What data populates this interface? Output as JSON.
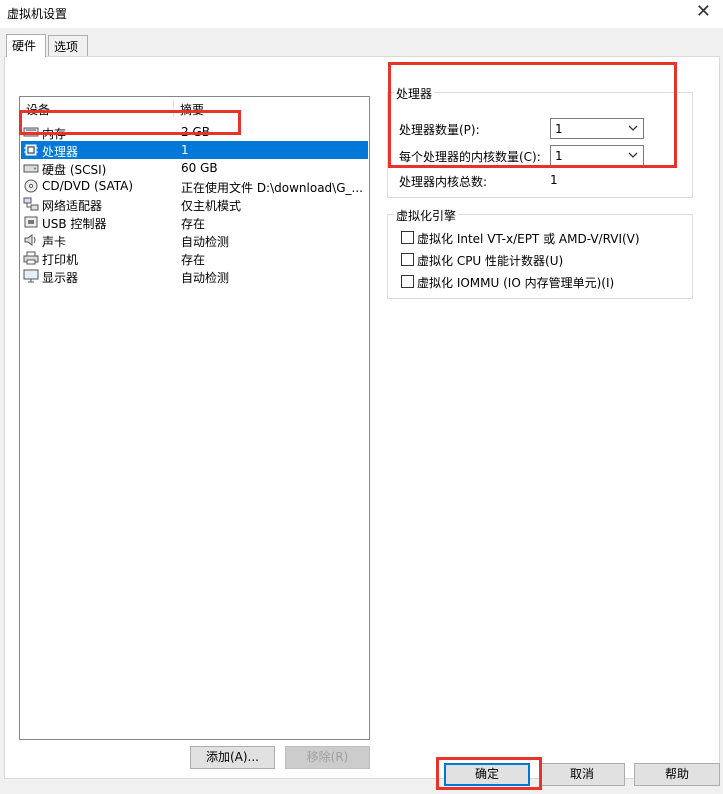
{
  "window": {
    "title": "虚拟机设置",
    "close_glyph": "✕"
  },
  "tabs": [
    {
      "label": "硬件"
    },
    {
      "label": "选项"
    }
  ],
  "device_list": {
    "headers": {
      "device": "设备",
      "summary": "摘要"
    },
    "rows": [
      {
        "name": "内存",
        "summary": "2 GB",
        "icon": "memory-icon"
      },
      {
        "name": "处理器",
        "summary": "1",
        "icon": "processor-icon"
      },
      {
        "name": "硬盘 (SCSI)",
        "summary": "60 GB",
        "icon": "hard-disk-icon"
      },
      {
        "name": "CD/DVD (SATA)",
        "summary": "正在使用文件 D:\\download\\G_...",
        "icon": "cd-dvd-icon"
      },
      {
        "name": "网络适配器",
        "summary": "仅主机模式",
        "icon": "network-adapter-icon"
      },
      {
        "name": "USB 控制器",
        "summary": "存在",
        "icon": "usb-icon"
      },
      {
        "name": "声卡",
        "summary": "自动检测",
        "icon": "speaker-icon"
      },
      {
        "name": "打印机",
        "summary": "存在",
        "icon": "printer-icon"
      },
      {
        "name": "显示器",
        "summary": "自动检测",
        "icon": "monitor-icon"
      }
    ],
    "selected_index": 1
  },
  "list_buttons": {
    "add": "添加(A)...",
    "remove": "移除(R)"
  },
  "processor_group": {
    "title": "处理器",
    "count_label": "处理器数量(P):",
    "count_value": "1",
    "cores_label": "每个处理器的内核数量(C):",
    "cores_value": "1",
    "total_label": "处理器内核总数:",
    "total_value": "1"
  },
  "virtualization_group": {
    "title": "虚拟化引擎",
    "options": [
      {
        "label": "虚拟化 Intel VT-x/EPT 或 AMD-V/RVI(V)",
        "checked": false
      },
      {
        "label": "虚拟化 CPU 性能计数器(U)",
        "checked": false
      },
      {
        "label": "虚拟化 IOMMU (IO 内存管理单元)(I)",
        "checked": false
      }
    ]
  },
  "dialog_buttons": {
    "ok": "确定",
    "cancel": "取消",
    "help": "帮助"
  },
  "colors": {
    "selection": "#0078d7",
    "highlight": "#e8332a"
  }
}
